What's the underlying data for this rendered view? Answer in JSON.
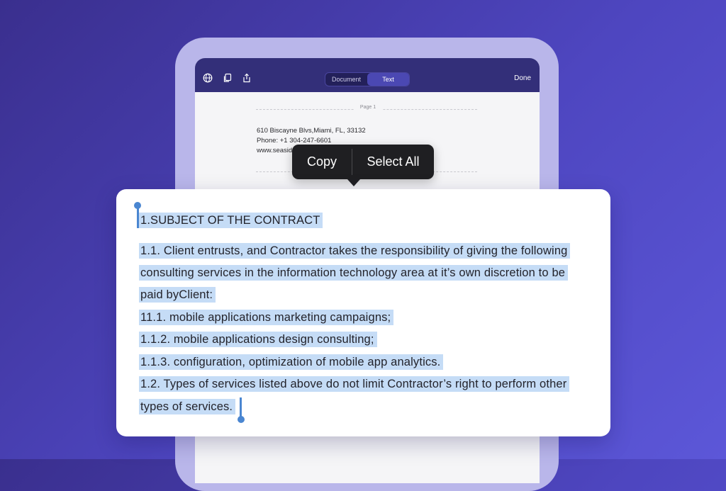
{
  "toolbar": {
    "icons": [
      "globe-icon",
      "document-copy-icon",
      "share-icon"
    ],
    "segments": [
      "Document",
      "Text"
    ],
    "active_segment": "Text",
    "done_label": "Done"
  },
  "page": {
    "label": "Page 1",
    "address_lines": [
      "610 Biscayne Blvs,Miami, FL, 33132",
      "Phone: +1 304-247-6601",
      "www.seasid"
    ]
  },
  "context_menu": {
    "copy_label": "Copy",
    "select_all_label": "Select All"
  },
  "selection": {
    "lines": [
      "1.SUBJECT OF THE CONTRACT",
      "1.1. Client entrusts, and Contractor takes the responsibility of giving the following",
      "consulting services in the information technology area at it’s own discretion to be",
      "paid byClient:",
      "11.1. mobile applications marketing campaigns;",
      "1.1.2. mobile applications design consulting;",
      "1.1.3. configuration, optimization of mobile app analytics.",
      "1.2. Types of services listed above do not limit Contractor’s right to perform other",
      "types of services."
    ]
  },
  "colors": {
    "background": "#4e46c0",
    "toolbar": "#332f79",
    "selection_highlight": "#c5dcf6",
    "selection_handle": "#4a86d1",
    "menu": "#1f1f22"
  }
}
